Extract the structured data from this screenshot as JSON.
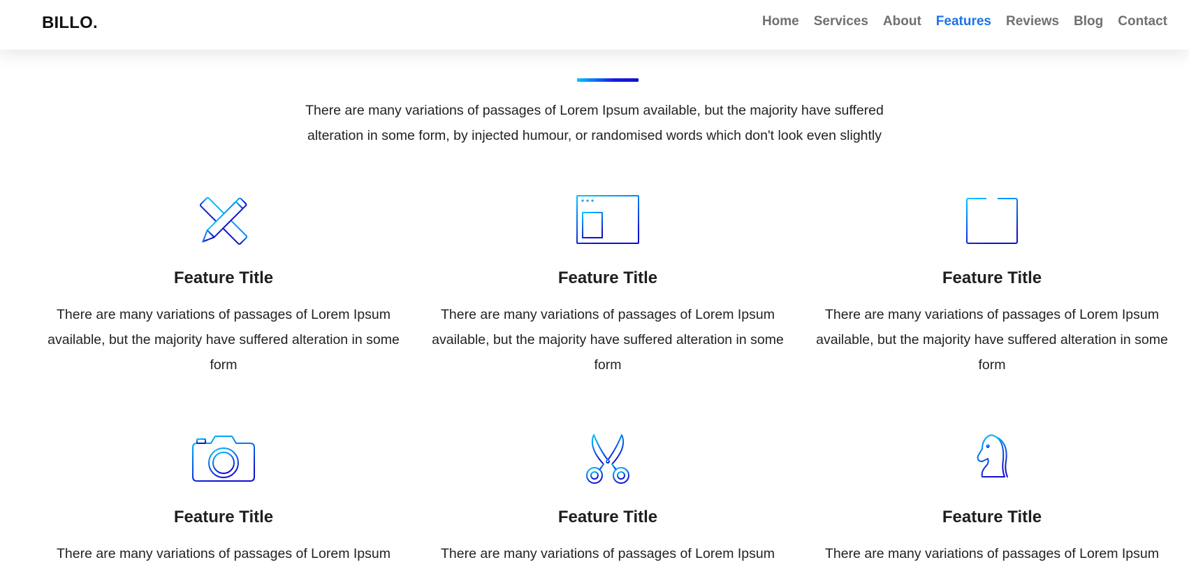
{
  "brand": "BILLO.",
  "nav": {
    "items": [
      "Home",
      "Services",
      "About",
      "Features",
      "Reviews",
      "Blog",
      "Contact"
    ],
    "active": "Features"
  },
  "colors": {
    "accent": "#1a73e8",
    "gradient_start": "#00c6ff",
    "gradient_end": "#1010d0"
  },
  "intro": "There are many variations of passages of Lorem Ipsum available, but the majority have suffered alteration in some form, by injected humour, or randomised words which don't look even slightly",
  "features": [
    {
      "icon": "pencil-ruler-icon",
      "title": "Feature Title",
      "description": "There are many variations of passages of Lorem Ipsum available, but the majority have suffered alteration in some form"
    },
    {
      "icon": "browser-layout-icon",
      "title": "Feature Title",
      "description": "There are many variations of passages of Lorem Ipsum available, but the majority have suffered alteration in some form"
    },
    {
      "icon": "calendar-icon",
      "title": "Feature Title",
      "description": "There are many variations of passages of Lorem Ipsum available, but the majority have suffered alteration in some form"
    },
    {
      "icon": "camera-icon",
      "title": "Feature Title",
      "description": "There are many variations of passages of Lorem Ipsum"
    },
    {
      "icon": "scissors-icon",
      "title": "Feature Title",
      "description": "There are many variations of passages of Lorem Ipsum"
    },
    {
      "icon": "chess-knight-icon",
      "title": "Feature Title",
      "description": "There are many variations of passages of Lorem Ipsum"
    }
  ]
}
